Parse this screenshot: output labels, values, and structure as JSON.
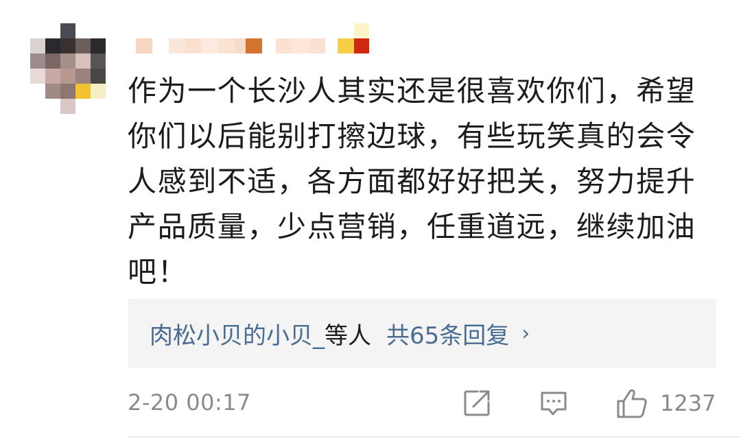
{
  "comment": {
    "text": "作为一个长沙人其实还是很喜欢你们，希望你们以后能别打擦边球，有些玩笑真的会令人感到不适，各方面都好好把关，努力提升产品质量，少点营销，任重道远，继续加油吧！",
    "replies": {
      "repliers": "肉松小贝的小贝_",
      "suffix": "等人",
      "count_text": "共65条回复",
      "chevron": "›"
    },
    "timestamp": "2-20 00:17",
    "actions": {
      "share_icon": "share-icon",
      "reply_icon": "comment-icon",
      "like_icon": "thumbs-up-icon",
      "like_count": "1237"
    }
  },
  "colors": {
    "text": "#1c1c1c",
    "link": "#4a6c91",
    "meta": "#8a8a8a",
    "reply_bg": "#f4f4f4"
  }
}
